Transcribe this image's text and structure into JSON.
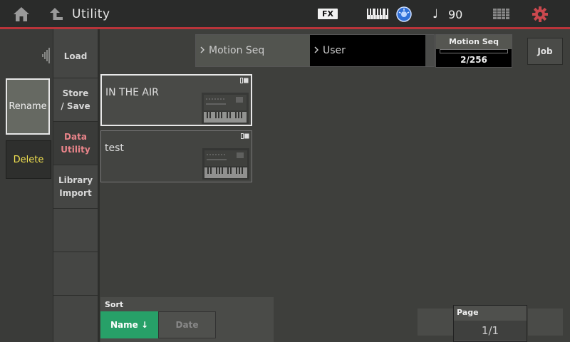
{
  "topbar": {
    "title": "Utility",
    "fx_label": "FX",
    "tempo": "90",
    "note_symbol": "♩",
    "accent_color": "#b9343a",
    "icons": [
      "home-icon",
      "up-arrow-icon",
      "keyboard-icon",
      "dial-icon",
      "note-icon",
      "grid-icon",
      "gear-icon"
    ]
  },
  "side_tabs": [
    {
      "label": "Load",
      "active": false
    },
    {
      "label": "Store\n/ Save",
      "active": false
    },
    {
      "label": "Data\nUtility",
      "active": true
    },
    {
      "label": "Library\nImport",
      "active": false
    },
    {
      "label": "",
      "active": false
    },
    {
      "label": "",
      "active": false
    },
    {
      "label": "",
      "active": false
    }
  ],
  "actions": {
    "rename": "Rename",
    "delete": "Delete"
  },
  "path": {
    "segment1": "Motion Seq",
    "segment2": "User"
  },
  "counter": {
    "label": "Motion Seq",
    "value": "2/256"
  },
  "job_label": "Job",
  "files": [
    {
      "name": "IN THE AIR",
      "selected": true
    },
    {
      "name": "test",
      "selected": false
    }
  ],
  "sort": {
    "label": "Sort",
    "name_option": "Name ↓",
    "date_option": "Date"
  },
  "page": {
    "label": "Page",
    "value": "1/1"
  }
}
